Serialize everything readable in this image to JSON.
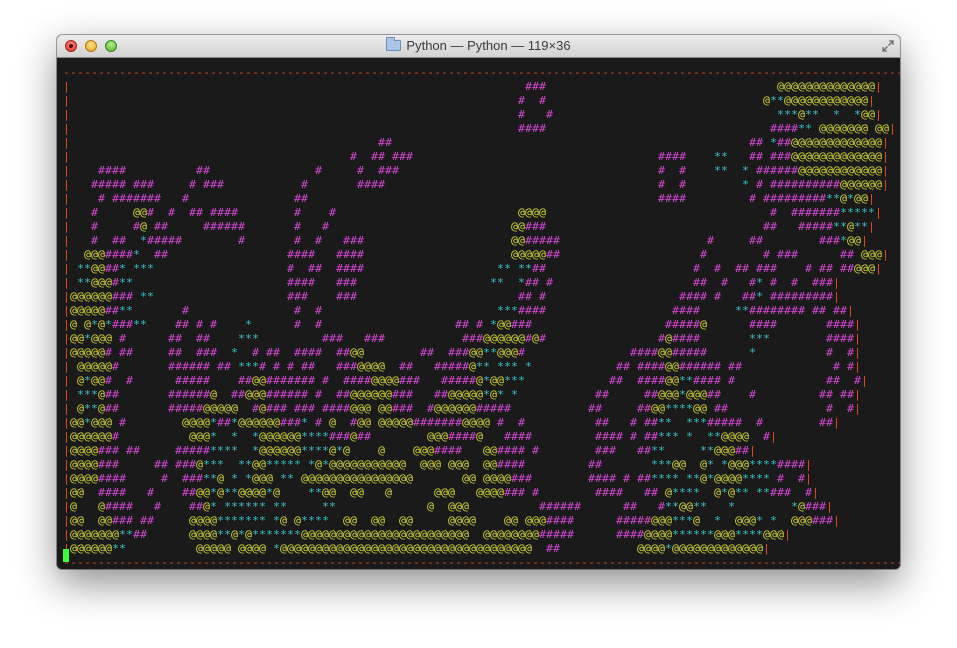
{
  "window": {
    "title": "Python — Python — 119×36",
    "buttons": {
      "close": "close-button",
      "minimize": "minimize-button",
      "zoom": "zoom-button"
    },
    "icons": {
      "folder": "folder-icon",
      "fullscreen": "fullscreen-arrows-icon"
    }
  },
  "terminal": {
    "background": "#1a1a1a",
    "colors": {
      "border": "#e64a19",
      "hash": "#d548d5",
      "at": "#d6d836",
      "star": "#36c3c8",
      "cursor": "#3cff3c"
    },
    "line_height": 14,
    "char_width": 7,
    "origin": [
      6,
      8
    ],
    "lines": [
      "------------------------------------------------------------------------------------------------------------------------",
      "|                                                                 ###                                 @@@@@@@@@@@@@@|",
      "|                                                                #  #                               @**@@@@@@@@@@@@|",
      "|                                                                #   #                                ***@**  *  *@@|",
      "|                                                                ####                                ####** @@@@@@@ @@|",
      "|                                            ##                                                   ## *##@@@@@@@@@@@@@|",
      "|                                        #  ## ###                                   ####    **   ## ###@@@@@@@@@@@@@|",
      "|    ####          ##               #     #  ###                                     #  #    **  * ######@@@@@@@@@@@@|",
      "|   ##### ###     # ###           #       ####                                       #  #        * # ##########@@@@@@|",
      "|    # #######   #               ##                                                  ####         # #########**@*@@|",
      "|   #     @@#  #  ## ####        #    #                          @@@@                                #  #######*****|",
      "|   #     #@ ##     ######       #   #                          @@###                               ##   #####**@**|",
      "|   #  ##  *#####        #       #  #   ###                     @@#####                     #     ##        ###*@@|",
      "|  @@@####*  ##                 ####   ####                     @@@@@##                    #        # ###      ## @@@|",
      "| **@@##* ***                   #  ##  ####                   ** **##                     #  #  ## ###    # ## ##@@@|",
      "| **@@@#**                      ####   ###                   **  *## #                    ##  #   #* #  #  ###|",
      "|@@@@@@### **                   ###    ###                       ## #                   #### #   ##* #########|",
      "|@@@@@##**       #               #  #                         ***####                  ####     **######## ## ##|",
      "|@ @*@*###**    ## # #    *      #  #                   ## # *@@###                   #####@      ####       ####|",
      "|@@*@@@ #      ##  ##    ***         ###   ###           ###@@@@@@#@#                #@####       ***        ####|",
      "|@@@@@# ##     ##  ###  *  # ##  ####  ##@@        ##  ###@@**@@@#               ####@@#####      *          #  #|",
      "| @@@@@#       ###### ## ***# # # ##   ###@@@@  ##   #####@** *** *            ## ####@@###### ##             # #|",
      "| @*@@#  #      #####    ##@@####### #  ####@@@@###   #####@*@@***            ##  ####@@**#### #             ##  #|",
      "| ***@##       ######@  ##@@@###### #  ##@@@@@@###   ##@@@@@*@* *           ##     ##@@@*@@@##    #         ## ##|",
      "| @**@##       #####@@@@@  #@### ### ####@@@ @@###  #@@@@@@#####           ##     ##@@****@@ ##              #  #|",
      "|@@*@@@ #        @@@@*##*@@@@@@###* # @  #@@ @@@@@#######@@@@ #  #          ##   # ##**  ***#####  #        ##|",
      "|@@@@@@#          @@@*  *  *@@@@@@****###@##        @@@####@   ####         #### # ##*** *  **@@@@  #|",
      "|@@@@### ##     #####****  *@@@@@@****@*@    @    @@@####   @@#### #        ###   ##**     **@@@##|",
      "|@@@@###     ## ###@***  **@@***** *@*@@@@@@@@@@@  @@@ @@@  @@####         ##       ***@@  @* *@@@****####|",
      "|@@@@####     #  ###**@ * *@@@ ** @@@@@@@@@@@@@@@@       @@ @@@@###        #### # ##**** **@*@@@@**** #  #|",
      "|@@  ####   #    ##@@*@**@@@@*@    **@@  @@   @      @@@   @@@@### #        ####   ## @****  @*@** **###  #|",
      "|@   @####   #    ##@* ****** **     **             @  @@@          ######      ##   #**@@**   *        *@###|",
      "|@@  @@### ##     @@@@******* *@ @****  @@  @@  @@     @@@@    @@ @@@####      #####@@@***@  *  @@@* *  @@@###|",
      "|@@@@@@@**##      @@@@**@*@*******@@@@@@@@@@@@@@@@@@@@@@@@  @@@@@@@@#####      ####@@@@******@@@****@@@|",
      "|@@@@@@**          @@@@@ @@@@ *@@@@@@@@@@@@@@@@@@@@@@@@@@@@@@@@@@@@  ##           @@@@*@@@@@@@@@@@@@|",
      "------------------------------------------------------------------------------------------------------------------------"
    ]
  }
}
